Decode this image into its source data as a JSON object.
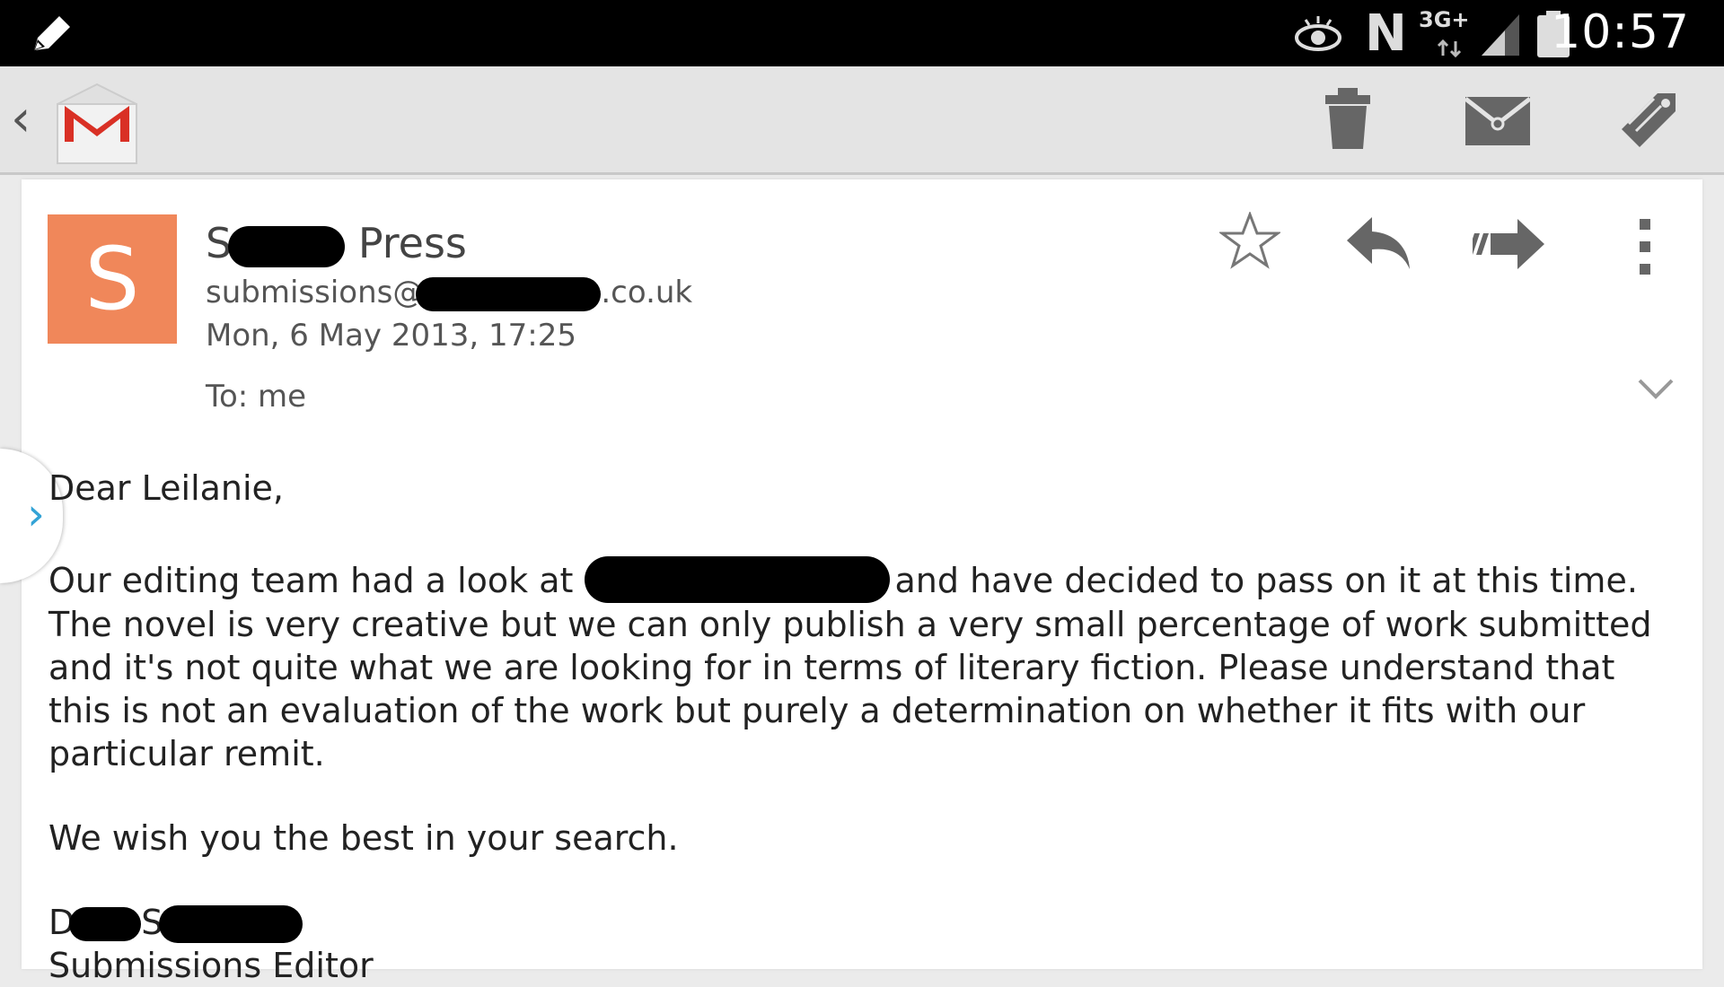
{
  "status_bar": {
    "network": "3G+",
    "nfc": "N",
    "time": "10:57",
    "icons": [
      "pencil-icon",
      "eye-icon",
      "nfc-icon",
      "network-icon",
      "signal-icon",
      "battery-icon"
    ]
  },
  "action_bar": {
    "back": "‹",
    "icons": [
      "gmail-logo-icon",
      "delete-icon",
      "mark-unread-icon",
      "label-icon"
    ]
  },
  "message": {
    "avatar_letter": "S",
    "avatar_color": "#f0875a",
    "sender_prefix": "S",
    "sender_suffix": "Press",
    "email_prefix": "submissions@",
    "email_suffix": ".co.uk",
    "date": "Mon, 6 May 2013, 17:25",
    "to": "To: me",
    "greeting": "Dear Leilanie,",
    "para1_start": "Our editing team had a look at ",
    "para1_rest": "and have decided to pass on it at this time. The novel is very creative but we can only publish a very small percentage of work submitted and it's not quite what we are looking for in terms of literary fiction. Please understand that this is not an evaluation of the work but purely a determination on whether it fits with our particular remit.",
    "closing": "We wish you the best in your search.",
    "sig_name_start": "D",
    "sig_name_mid": "S",
    "sig_title": "Submissions Editor"
  }
}
